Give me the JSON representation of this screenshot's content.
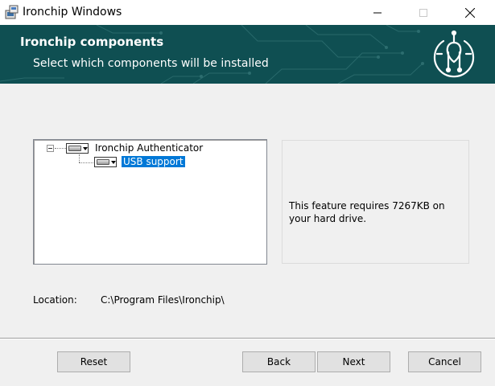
{
  "window": {
    "title": "Ironchip Windows"
  },
  "banner": {
    "title": "Ironchip components",
    "subtitle": "Select which components will be installed"
  },
  "tree": {
    "items": [
      {
        "label": "Ironchip Authenticator",
        "expanded": true,
        "selected": false,
        "icon": "drive-icon"
      },
      {
        "label": "USB support",
        "selected": true,
        "icon": "drive-icon"
      }
    ]
  },
  "description": {
    "text": "This feature requires 7267KB on your hard drive."
  },
  "location": {
    "label": "Location:",
    "value": "C:\\Program Files\\Ironchip\\"
  },
  "buttons": {
    "reset": "Reset",
    "back": "Back",
    "next": "Next",
    "cancel": "Cancel"
  },
  "colors": {
    "banner": "#0f4f52",
    "selection": "#0078d7"
  }
}
